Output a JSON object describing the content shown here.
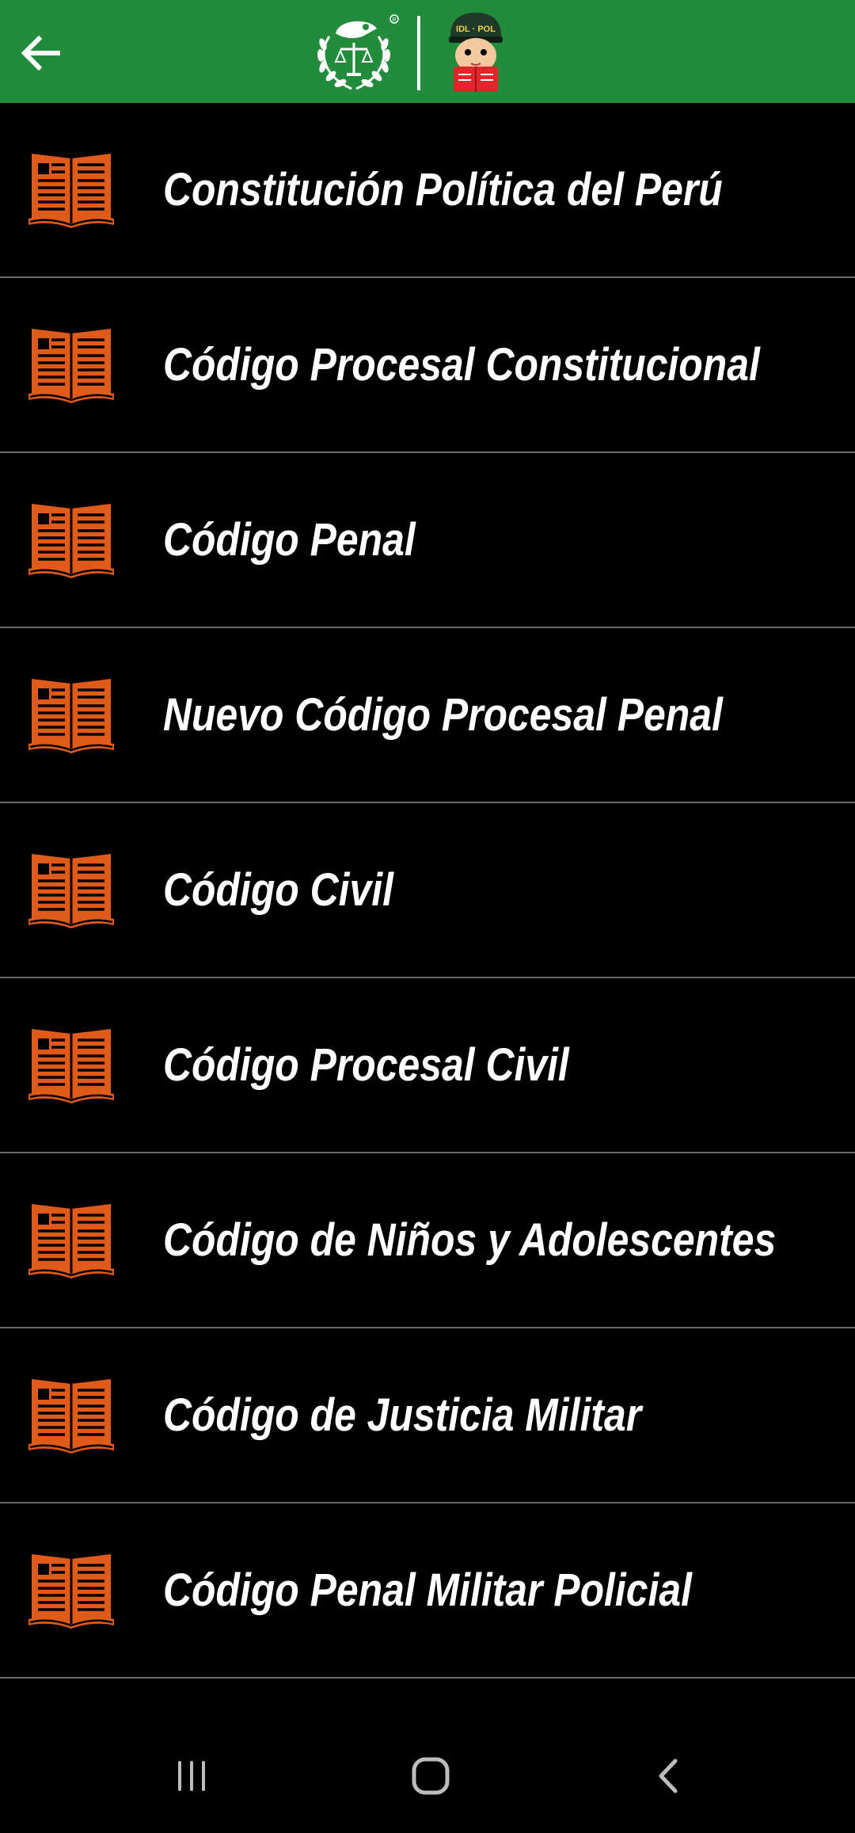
{
  "header": {
    "back_icon": "arrow-left-icon",
    "emblem_logo": "police-cap-scales-laurel-emblem",
    "mascot_logo": "idl-pol-mascot-reading-book",
    "mascot_text": "IDL · POL",
    "colors": {
      "bar": "#228b3c",
      "foreground": "#ffffff"
    }
  },
  "laws": {
    "icon": "open-book-icon",
    "accent_color": "#e05a1a",
    "items": [
      {
        "label": "Constitución Política del Perú"
      },
      {
        "label": "Código Procesal Constitucional"
      },
      {
        "label": "Código Penal"
      },
      {
        "label": "Nuevo Código Procesal Penal"
      },
      {
        "label": "Código Civil"
      },
      {
        "label": "Código Procesal Civil"
      },
      {
        "label": "Código de Niños y Adolescentes"
      },
      {
        "label": "Código de Justicia Militar"
      },
      {
        "label": "Código Penal Militar Policial"
      }
    ]
  },
  "system_nav": {
    "recents_icon": "recent-apps-icon",
    "home_icon": "home-icon",
    "back_icon": "back-chevron-icon"
  }
}
